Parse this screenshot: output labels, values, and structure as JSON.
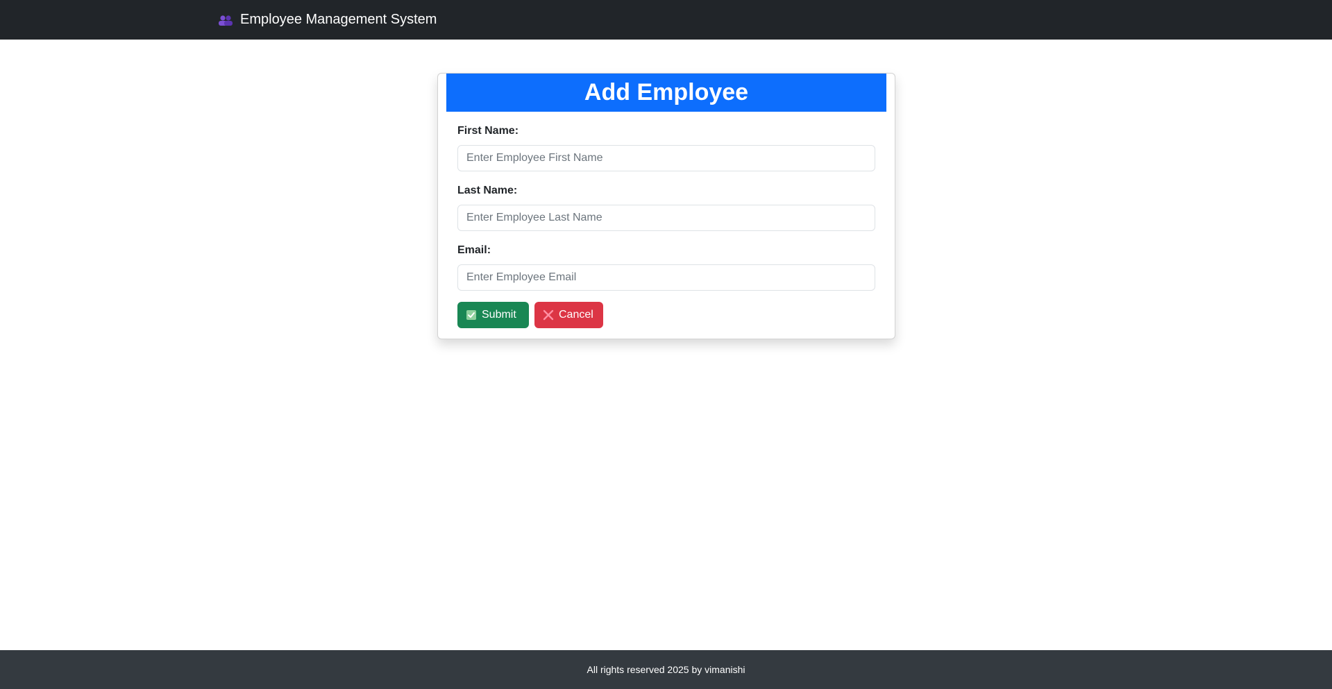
{
  "navbar": {
    "brand_icon": "people-icon",
    "brand_text": "Employee Management System"
  },
  "form": {
    "title": "Add Employee",
    "first_name": {
      "label": "First Name:",
      "placeholder": "Enter Employee First Name",
      "value": ""
    },
    "last_name": {
      "label": "Last Name:",
      "placeholder": "Enter Employee Last Name",
      "value": ""
    },
    "email": {
      "label": "Email:",
      "placeholder": "Enter Employee Email",
      "value": ""
    },
    "submit": {
      "icon": "check-box-icon",
      "label": "Submit"
    },
    "cancel": {
      "icon": "cross-icon",
      "label": "Cancel"
    }
  },
  "footer": {
    "text": "All rights reserved 2025 by vimanishi"
  },
  "colors": {
    "navbar": "#212529",
    "primary": "#0d6efd",
    "success": "#198754",
    "danger": "#dc3545",
    "footer": "#343a40"
  }
}
